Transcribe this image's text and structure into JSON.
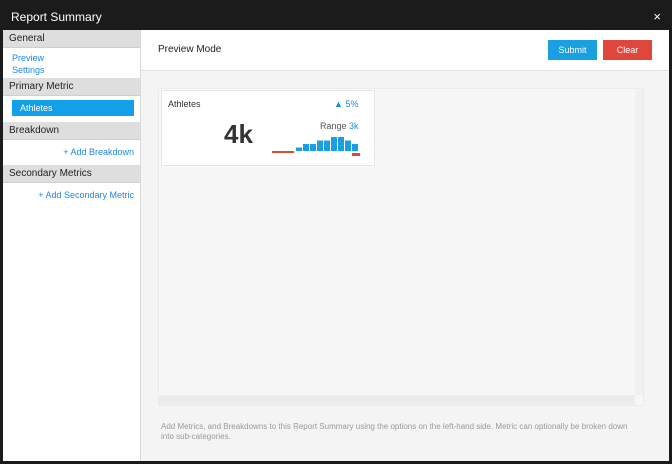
{
  "window": {
    "title": "Report Summary",
    "close_icon": "×"
  },
  "sidebar": {
    "general": {
      "title": "General",
      "items": [
        "Preview",
        "Settings"
      ]
    },
    "primary_metric": {
      "title": "Primary Metric",
      "selected": "Athletes"
    },
    "breakdown": {
      "title": "Breakdown",
      "add_label": "+ Add Breakdown"
    },
    "secondary_metrics": {
      "title": "Secondary Metrics",
      "add_label": "+ Add Secondary Metric"
    }
  },
  "main": {
    "mode": "Preview Mode",
    "submit_label": "Submit",
    "cancel_label": "Clear",
    "widget": {
      "title": "Athletes",
      "trend": "5%",
      "value": "4k",
      "range_label": "Range",
      "range_value": "3k",
      "sparkline": {
        "type": "bar",
        "values": [
          1,
          2,
          2,
          3,
          3,
          4,
          4,
          3,
          2
        ]
      }
    },
    "footer_note": "Add Metrics, and Breakdowns to this Report Summary using the options on the left-hand side. Metric can optionally be broken down into sub-categories."
  },
  "colors": {
    "accent": "#1a9fe0",
    "danger": "#e0473c",
    "title_bar": "#1b1b1b"
  }
}
